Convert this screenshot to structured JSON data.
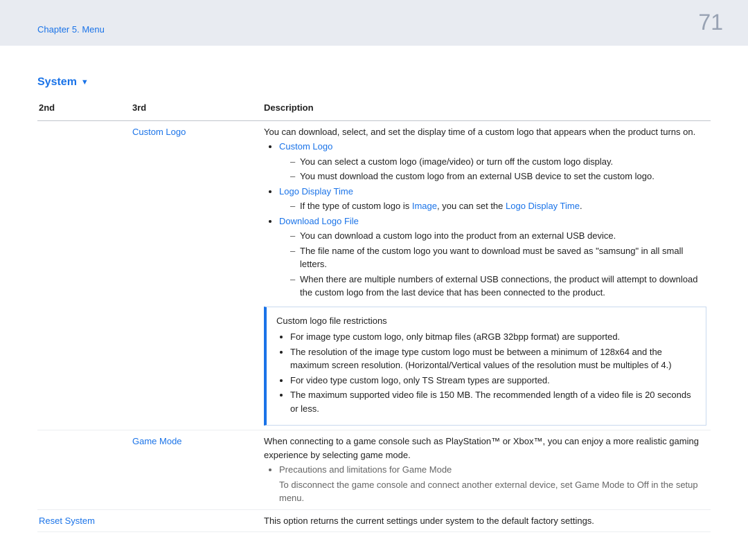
{
  "header": {
    "chapter": "Chapter 5. Menu",
    "page_number": "71"
  },
  "section": {
    "title": "System",
    "dropdown_icon": "▼"
  },
  "table": {
    "headers": {
      "c1": "2nd",
      "c2": "3rd",
      "c3": "Description"
    },
    "rows": {
      "custom_logo": {
        "c2": "Custom Logo",
        "intro": "You can download, select, and set the display time of a custom logo that appears when the product turns on.",
        "sub1": {
          "title": "Custom Logo",
          "d1": "You can select a custom logo (image/video) or turn off the custom logo display.",
          "d2": "You must download the custom logo from an external USB device to set the custom logo."
        },
        "sub2": {
          "title": "Logo Display Time",
          "d_pre": "If the type of custom logo is ",
          "d_term1": "Image",
          "d_mid": ", you can set the ",
          "d_term2": "Logo Display Time",
          "d_post": "."
        },
        "sub3": {
          "title": "Download Logo File",
          "d1": "You can download a custom logo into the product from an external USB device.",
          "d2": "The file name of the custom logo you want to download must be saved as \"samsung\" in all small letters.",
          "d3": "When there are multiple numbers of external USB connections, the product will attempt to download the custom logo from the last device that has been connected to the product."
        },
        "note": {
          "title": "Custom logo file restrictions",
          "b1": "For image type custom logo, only bitmap files (aRGB 32bpp format) are supported.",
          "b2": "The resolution of the image type custom logo must be between a minimum of 128x64 and the maximum screen resolution. (Horizontal/Vertical values of the resolution must be multiples of 4.)",
          "b3": "For video type custom logo, only TS Stream types are supported.",
          "b4": "The maximum supported video file is 150 MB. The recommended length of a video file is 20 seconds or less."
        }
      },
      "game_mode": {
        "c2": "Game Mode",
        "intro": "When connecting to a game console such as PlayStation™ or Xbox™, you can enjoy a more realistic gaming experience by selecting game mode.",
        "sub_title": "Precautions and limitations for Game Mode",
        "sub_line": "To disconnect the game console and connect another external device, set Game Mode to Off in the setup menu."
      },
      "reset_system": {
        "c1": "Reset System",
        "intro": "This option returns the current settings under system to the default factory settings."
      }
    }
  }
}
